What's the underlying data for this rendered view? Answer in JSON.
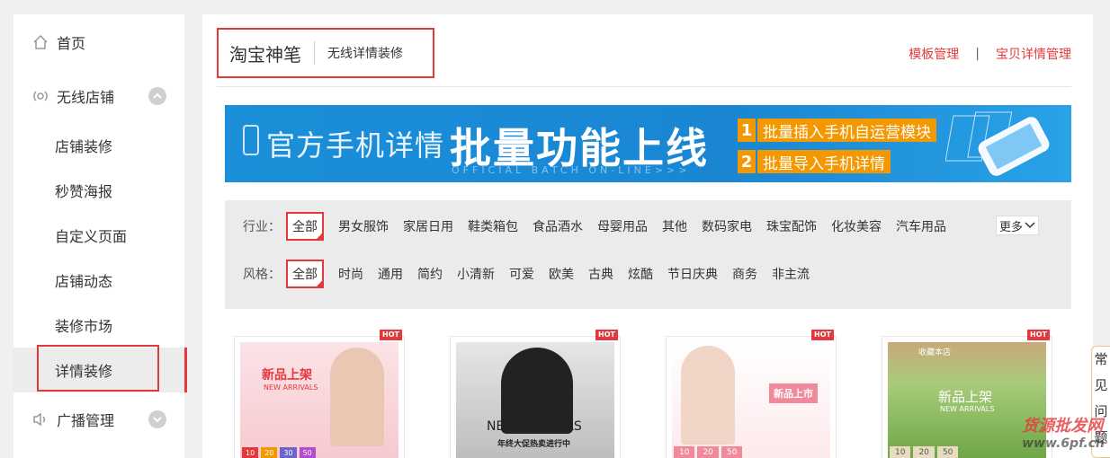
{
  "sidebar": {
    "items": [
      {
        "label": "首页",
        "icon": "home-icon"
      },
      {
        "label": "无线店铺",
        "icon": "wireless-icon",
        "expanded": true
      },
      {
        "label": "店铺装修"
      },
      {
        "label": "秒赞海报"
      },
      {
        "label": "自定义页面"
      },
      {
        "label": "店铺动态"
      },
      {
        "label": "装修市场"
      },
      {
        "label": "详情装修",
        "active": true
      },
      {
        "label": "广播管理",
        "icon": "speaker-icon"
      }
    ]
  },
  "header": {
    "title": "淘宝神笔",
    "subtitle": "无线详情装修",
    "link_templates": "模板管理",
    "separator": "|",
    "link_details": "宝贝详情管理"
  },
  "banner": {
    "left_text": "官方手机详情",
    "big_text": "批量功能上线",
    "english_text": "OFFICIAL BATCH ON-LINE>>>",
    "feature1_num": "1",
    "feature1": "批量插入手机自运营模块",
    "feature2_num": "2",
    "feature2": "批量导入手机详情"
  },
  "filter": {
    "industry_label": "行业：",
    "industry_options": [
      "全部",
      "男女服饰",
      "家居日用",
      "鞋类箱包",
      "食品酒水",
      "母婴用品",
      "其他",
      "数码家电",
      "珠宝配饰",
      "化妆美容",
      "汽车用品"
    ],
    "style_label": "风格：",
    "style_options": [
      "全部",
      "时尚",
      "通用",
      "简约",
      "小清新",
      "可爱",
      "欧美",
      "古典",
      "炫酷",
      "节日庆典",
      "商务",
      "非主流"
    ],
    "more_label": "更多"
  },
  "templates": [
    {
      "badge": "HOT",
      "headline": "新品上架",
      "sub": "NEW ARRIVALS",
      "prices": [
        "10",
        "20",
        "30",
        "50"
      ]
    },
    {
      "badge": "HOT",
      "headline": "NEW ARRIVALS",
      "sub": "年终大促热卖进行中"
    },
    {
      "badge": "HOT",
      "headline": "新品上市",
      "prices": [
        "10",
        "20",
        "50"
      ]
    },
    {
      "badge": "HOT",
      "headline": "新品上架",
      "sub": "NEW ARRIVALS",
      "top": "收藏本店",
      "prices": [
        "10",
        "20",
        "50"
      ]
    }
  ],
  "float_panel": {
    "chars": [
      "常",
      "见",
      "问",
      "题"
    ]
  },
  "watermark": {
    "text": "货源批发网",
    "domain": "www.6pf.cn"
  },
  "colors": {
    "accent": "#e4393c",
    "banner_blue": "#1a86d3",
    "tag_orange": "#f39800"
  }
}
